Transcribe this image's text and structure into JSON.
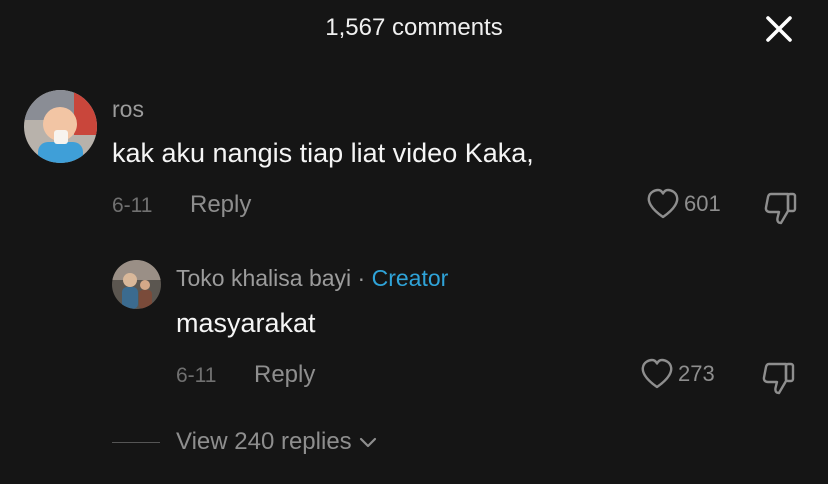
{
  "header": {
    "title": "1,567 comments"
  },
  "comment": {
    "username": "ros",
    "text": "kak aku nangis tiap liat video Kaka,",
    "date": "6-11",
    "reply_label": "Reply",
    "likes": "601"
  },
  "reply": {
    "username": "Toko khalisa bayi",
    "separator": "·",
    "badge": "Creator",
    "text": "masyarakat",
    "date": "6-11",
    "reply_label": "Reply",
    "likes": "273"
  },
  "view_replies": {
    "label": "View 240 replies"
  },
  "colors": {
    "background": "#151515",
    "creator_badge": "#2fa3d8",
    "muted": "#8e8e8e"
  },
  "icons": [
    "close-icon",
    "heart-icon",
    "dislike-icon",
    "chevron-down-icon"
  ]
}
